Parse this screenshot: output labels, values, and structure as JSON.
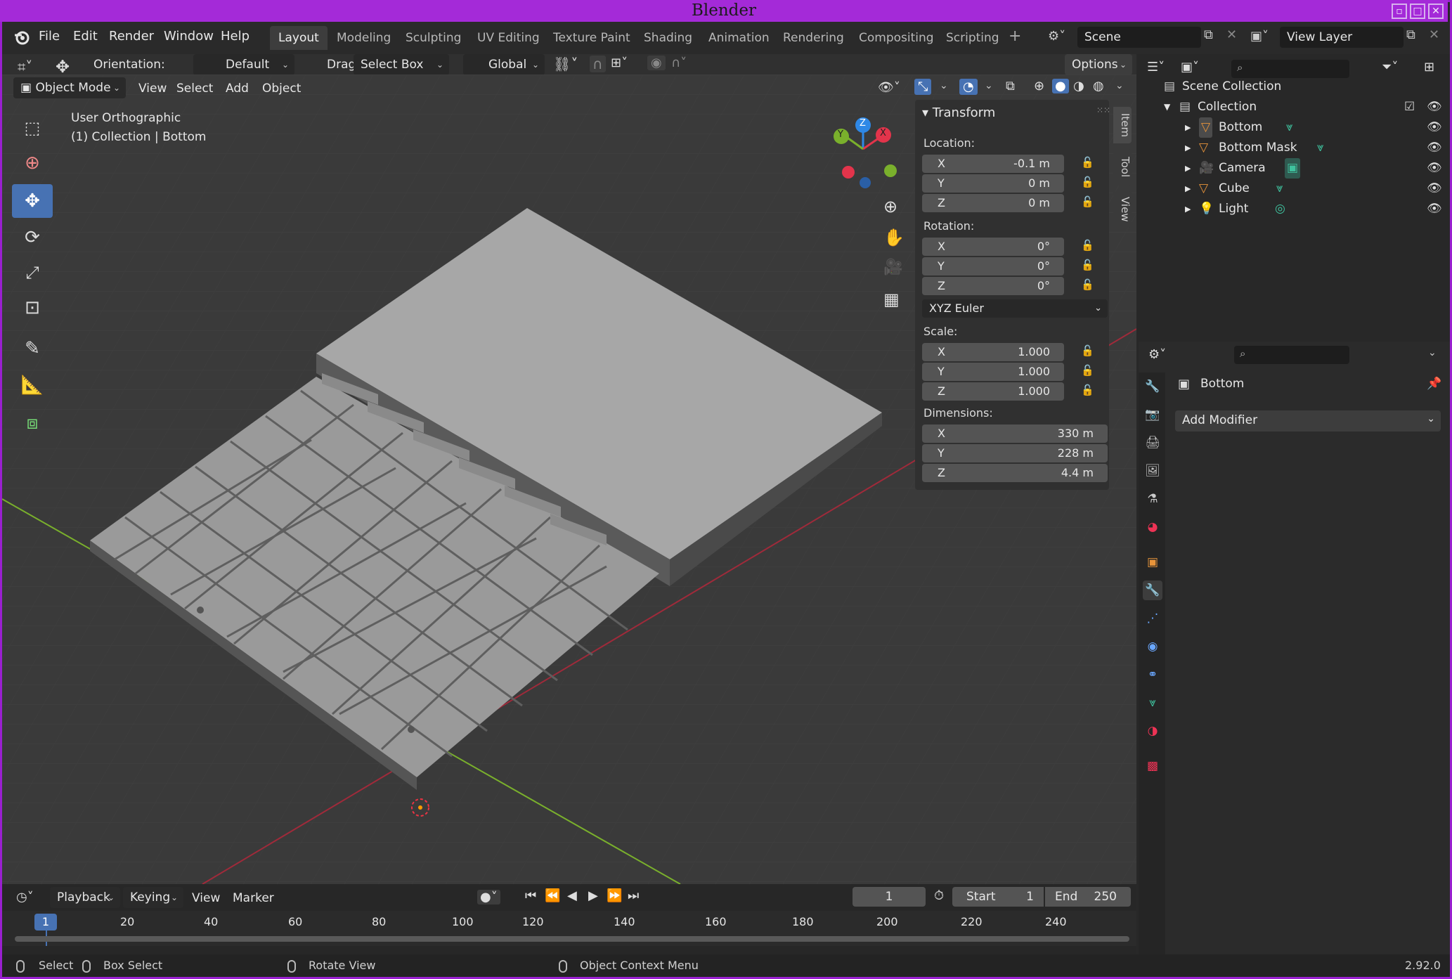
{
  "window": {
    "title": "Blender"
  },
  "menu": [
    "File",
    "Edit",
    "Render",
    "Window",
    "Help"
  ],
  "workspaces": [
    "Layout",
    "Modeling",
    "Sculpting",
    "UV Editing",
    "Texture Paint",
    "Shading",
    "Animation",
    "Rendering",
    "Compositing",
    "Scripting"
  ],
  "scene": {
    "name": "Scene",
    "view_layer": "View Layer"
  },
  "tool_header": {
    "orientation_label": "Orientation:",
    "orientation_value": "Default",
    "drag_label": "Drag:",
    "drag_value": "Select Box",
    "transform_orientation": "Global",
    "options_label": "Options"
  },
  "viewport_header": {
    "mode": "Object Mode",
    "menus": [
      "View",
      "Select",
      "Add",
      "Object"
    ]
  },
  "viewport": {
    "view_name": "User Orthographic",
    "context": "(1) Collection | Bottom",
    "gizmo_axes": [
      "X",
      "Y",
      "Z"
    ]
  },
  "npanel": {
    "title": "Transform",
    "location_label": "Location:",
    "location": [
      {
        "axis": "X",
        "value": "-0.1 m"
      },
      {
        "axis": "Y",
        "value": "0 m"
      },
      {
        "axis": "Z",
        "value": "0 m"
      }
    ],
    "rotation_label": "Rotation:",
    "rotation": [
      {
        "axis": "X",
        "value": "0°"
      },
      {
        "axis": "Y",
        "value": "0°"
      },
      {
        "axis": "Z",
        "value": "0°"
      }
    ],
    "rotation_mode": "XYZ Euler",
    "scale_label": "Scale:",
    "scale": [
      {
        "axis": "X",
        "value": "1.000"
      },
      {
        "axis": "Y",
        "value": "1.000"
      },
      {
        "axis": "Z",
        "value": "1.000"
      }
    ],
    "dimensions_label": "Dimensions:",
    "dimensions": [
      {
        "axis": "X",
        "value": "330 m"
      },
      {
        "axis": "Y",
        "value": "228 m"
      },
      {
        "axis": "Z",
        "value": "4.4 m"
      }
    ],
    "tabs": [
      "Item",
      "Tool",
      "View"
    ]
  },
  "outliner": {
    "root": "Scene Collection",
    "collection": "Collection",
    "items": [
      "Bottom",
      "Bottom Mask",
      "Camera",
      "Cube",
      "Light"
    ]
  },
  "properties": {
    "object_name": "Bottom",
    "add_modifier": "Add Modifier"
  },
  "timeline": {
    "menus": [
      "Playback",
      "Keying",
      "View",
      "Marker"
    ],
    "current_frame": "1",
    "start_label": "Start",
    "start": "1",
    "end_label": "End",
    "end": "250",
    "ruler": [
      "1",
      "20",
      "40",
      "60",
      "80",
      "100",
      "120",
      "140",
      "160",
      "180",
      "200",
      "220",
      "240"
    ]
  },
  "statusbar": {
    "select": "Select",
    "box_select": "Box Select",
    "rotate_view": "Rotate View",
    "context_menu": "Object Context Menu",
    "version": "2.92.0"
  },
  "colors": {
    "frame": "#9a1fd0",
    "accent": "#4772b3",
    "axis_x": "#e3344b",
    "axis_y": "#7ab02c",
    "axis_z": "#2e88e6"
  }
}
